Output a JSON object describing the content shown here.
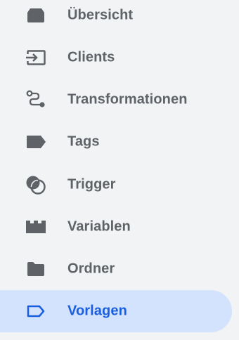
{
  "nav": {
    "items": [
      {
        "label": "Übersicht",
        "icon": "overview-icon"
      },
      {
        "label": "Clients",
        "icon": "clients-icon"
      },
      {
        "label": "Transformationen",
        "icon": "transformations-icon"
      },
      {
        "label": "Tags",
        "icon": "tag-icon"
      },
      {
        "label": "Trigger",
        "icon": "trigger-icon"
      },
      {
        "label": "Variablen",
        "icon": "variables-icon"
      },
      {
        "label": "Ordner",
        "icon": "folder-icon"
      },
      {
        "label": "Vorlagen",
        "icon": "template-icon",
        "active": true
      }
    ]
  },
  "colors": {
    "background": "#f1f3f4",
    "icon_default": "#5f6368",
    "label_default": "#5f6368",
    "active_background": "#d3e3fd",
    "active_accent": "#1a5fe0"
  }
}
